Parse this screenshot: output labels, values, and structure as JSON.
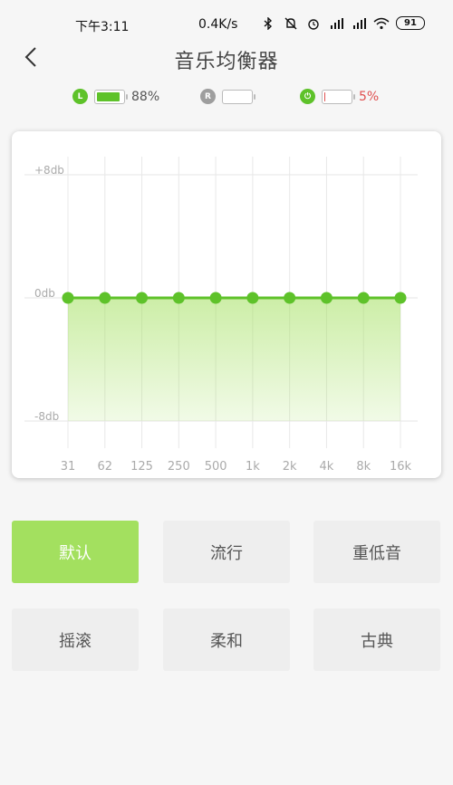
{
  "status_bar": {
    "time": "下午3:11",
    "net_speed": "0.4K/s",
    "battery": "91"
  },
  "header": {
    "title": "音乐均衡器",
    "back_icon": "chevron-left-icon"
  },
  "channels": [
    {
      "badge": "L",
      "badge_color": "#5ec22a",
      "level_pct": 88,
      "fill_color": "#5ec22a",
      "label": "88%",
      "label_color": "#555555"
    },
    {
      "badge": "R",
      "badge_color": "#9e9e9e",
      "level_pct": 0,
      "fill_color": "#9e9e9e",
      "label": "",
      "label_color": "#555555"
    },
    {
      "badge": "⏻",
      "badge_color": "#5ec22a",
      "level_pct": 5,
      "fill_color": "#e05050",
      "label": "5%",
      "label_color": "#e05050"
    }
  ],
  "chart_data": {
    "type": "line",
    "categories": [
      "31",
      "62",
      "125",
      "250",
      "500",
      "1k",
      "2k",
      "4k",
      "8k",
      "16k"
    ],
    "values": [
      0,
      0,
      0,
      0,
      0,
      0,
      0,
      0,
      0,
      0
    ],
    "y_labels": [
      "+8db",
      "0db",
      "-8db"
    ],
    "ylim": [
      -8,
      8
    ],
    "line_color": "#5ec22a",
    "fill_color": "#a3e05f",
    "grid": true
  },
  "presets": [
    {
      "label": "默认",
      "active": true
    },
    {
      "label": "流行",
      "active": false
    },
    {
      "label": "重低音",
      "active": false
    },
    {
      "label": "摇滚",
      "active": false
    },
    {
      "label": "柔和",
      "active": false
    },
    {
      "label": "古典",
      "active": false
    }
  ]
}
